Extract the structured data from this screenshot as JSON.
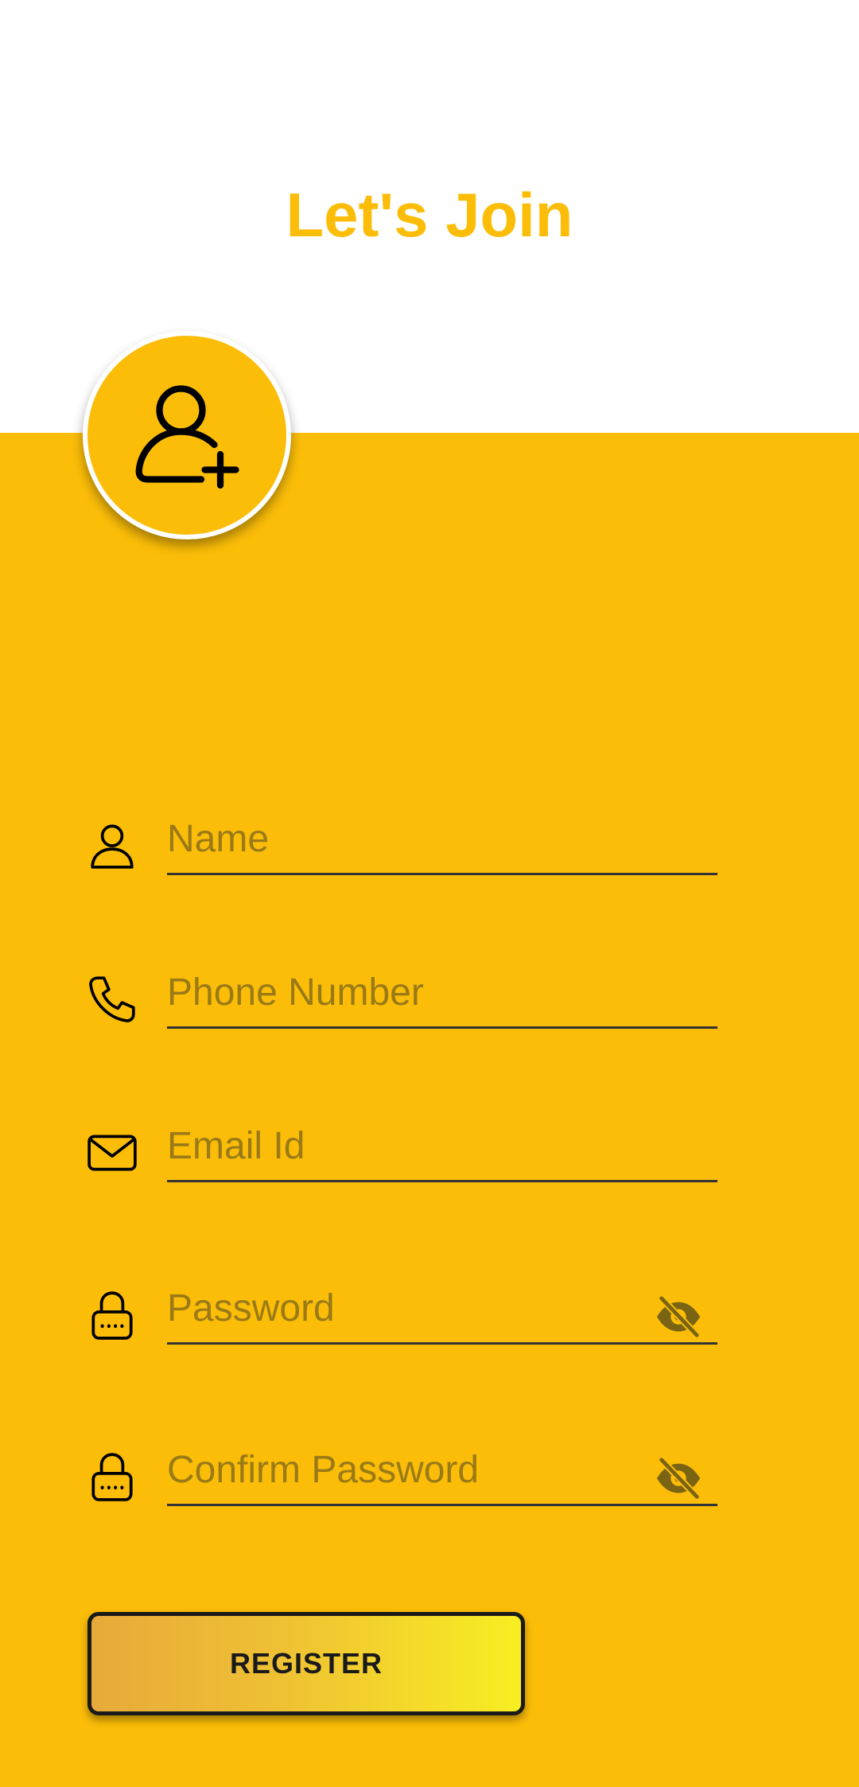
{
  "header": {
    "title": "Let's Join"
  },
  "avatar": {
    "icon": "add-user-icon"
  },
  "form": {
    "fields": [
      {
        "name": "name",
        "icon": "person-icon",
        "placeholder": "Name",
        "value": ""
      },
      {
        "name": "phone",
        "icon": "phone-icon",
        "placeholder": "Phone Number",
        "value": ""
      },
      {
        "name": "email",
        "icon": "mail-icon",
        "placeholder": "Email Id",
        "value": ""
      },
      {
        "name": "password",
        "icon": "lock-icon",
        "placeholder": "Password",
        "value": "",
        "toggle_icon": "eye-off-icon"
      },
      {
        "name": "confirm_password",
        "icon": "lock-icon",
        "placeholder": "Confirm Password",
        "value": "",
        "toggle_icon": "eye-off-icon"
      }
    ],
    "register_label": "REGISTER"
  },
  "colors": {
    "accent": "#FBBD08",
    "background_top": "#FFFFFF",
    "placeholder": "#9A7A17",
    "button_gradient_start": "#E7AA3A",
    "button_gradient_end": "#F8EE22"
  }
}
